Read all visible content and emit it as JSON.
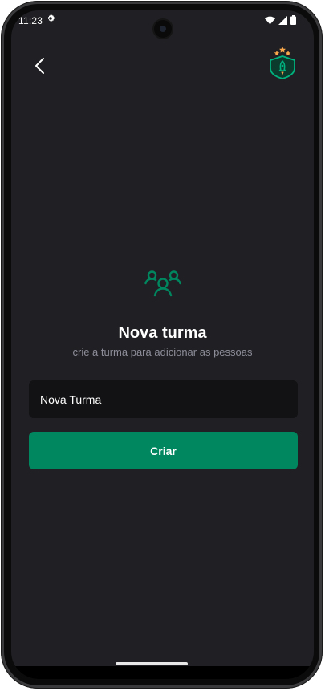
{
  "status_bar": {
    "time": "11:23",
    "icons": [
      "gear-icon",
      "wifi-icon",
      "signal-icon",
      "battery-icon"
    ]
  },
  "header": {
    "back_icon": "chevron-left-icon",
    "logo_icon": "shield-rocket-logo-icon"
  },
  "main": {
    "icon": "users-group-icon",
    "title": "Nova turma",
    "subtitle": "crie a turma para adicionar as pessoas",
    "input": {
      "value": "Nova Turma",
      "placeholder": ""
    },
    "submit_label": "Criar"
  },
  "colors": {
    "background": "#202024",
    "input_background": "#121214",
    "accent": "#00875f",
    "subtitle": "#8d8d99",
    "star": "#fba94c"
  }
}
